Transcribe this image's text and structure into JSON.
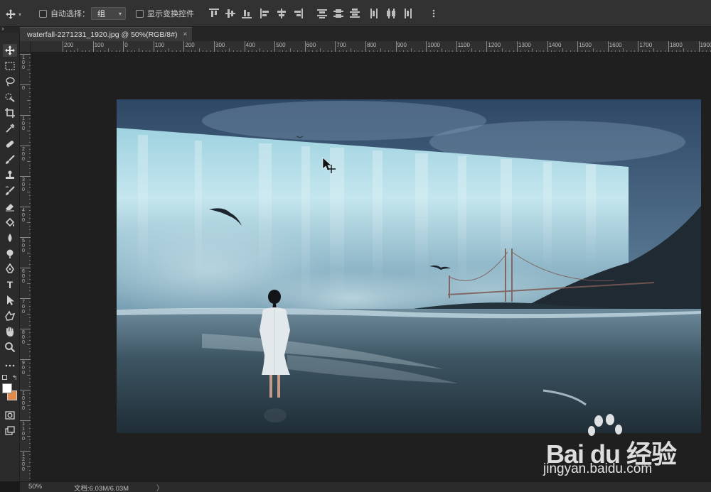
{
  "options_bar": {
    "auto_select_label": "自动选择：",
    "auto_select_target": "组",
    "show_transform_label": "显示变换控件",
    "auto_select_checked": false,
    "show_transform_checked": false
  },
  "document": {
    "tab_title": "waterfall-2271231_1920.jpg @ 50%(RGB/8#)",
    "close_label": "×"
  },
  "ruler": {
    "horizontal_labels": [
      "200",
      "100",
      "0",
      "100",
      "200",
      "300",
      "400",
      "500",
      "600",
      "700",
      "800",
      "900",
      "1000",
      "1100",
      "1200",
      "1300",
      "1400",
      "1500",
      "1600",
      "1700",
      "1800",
      "1900"
    ],
    "vertical_labels": [
      "1\n0\n0",
      "0",
      "1\n0\n0",
      "2\n0\n0",
      "3\n0\n0",
      "4\n0\n0",
      "5\n0\n0",
      "6\n0\n0",
      "7\n0\n0",
      "8\n0\n0",
      "9\n0\n0",
      "1\n0\n0\n0",
      "1\n1\n0\n0",
      "1\n2\n0\n0"
    ]
  },
  "toolbar": {
    "tools": [
      "move-tool",
      "rectangular-marquee-tool",
      "lasso-tool",
      "quick-selection-tool",
      "crop-tool",
      "eyedropper-tool",
      "healing-brush-tool",
      "brush-tool",
      "clone-stamp-tool",
      "history-brush-tool",
      "eraser-tool",
      "paint-bucket-tool",
      "blur-tool",
      "dodge-tool",
      "pen-tool",
      "type-tool",
      "path-selection-tool",
      "custom-shape-tool",
      "hand-tool",
      "zoom-tool",
      "more-tools"
    ],
    "type_tool_glyph": "T",
    "foreground_color": "#ffffff",
    "background_color": "#e08a4a"
  },
  "status_bar": {
    "zoom": "50%",
    "doc_info": "文档:6.03M/6.03M",
    "arrow": "〉"
  },
  "watermark": {
    "brand": "Bai du 经验",
    "url": "jingyan.baidu.com"
  }
}
